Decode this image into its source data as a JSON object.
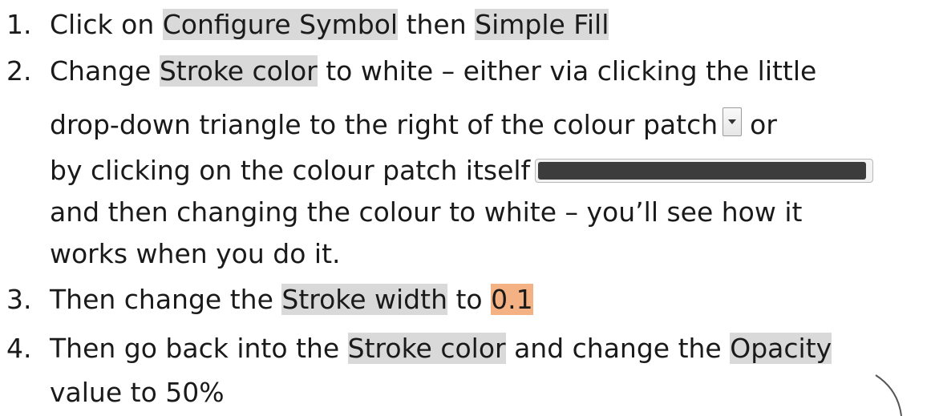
{
  "items": [
    {
      "number": "1.",
      "parts": {
        "a": "Click on ",
        "b": "Configure Symbol",
        "c": " then ",
        "d": "Simple Fill"
      }
    },
    {
      "number": "2.",
      "line1": {
        "a": "Change ",
        "b": "Stroke color",
        "c": " to white – either via clicking the little"
      },
      "line2": {
        "a": "drop-down triangle to the right of the colour patch",
        "b": "or"
      },
      "line3": {
        "a": "by clicking on the colour patch itself"
      },
      "line4": {
        "a": "and then changing the colour to white – you’ll see how it"
      },
      "line5": {
        "a": "works when you do it."
      }
    },
    {
      "number": "3.",
      "parts": {
        "a": "Then change the ",
        "b": "Stroke width",
        "c": " to ",
        "d": "0.1"
      }
    },
    {
      "number": "4.",
      "line1": {
        "a": "Then go back into the ",
        "b": "Stroke color",
        "c": " and change the ",
        "d": "Opacity"
      },
      "line2": {
        "a": "value to 50%"
      }
    }
  ],
  "colors": {
    "highlight_gray": "#d9d9d9",
    "highlight_orange": "#f4b183",
    "patch_color": "#3c3c3c"
  },
  "icons": [
    "dropdown-triangle-icon",
    "colour-patch-swatch"
  ]
}
